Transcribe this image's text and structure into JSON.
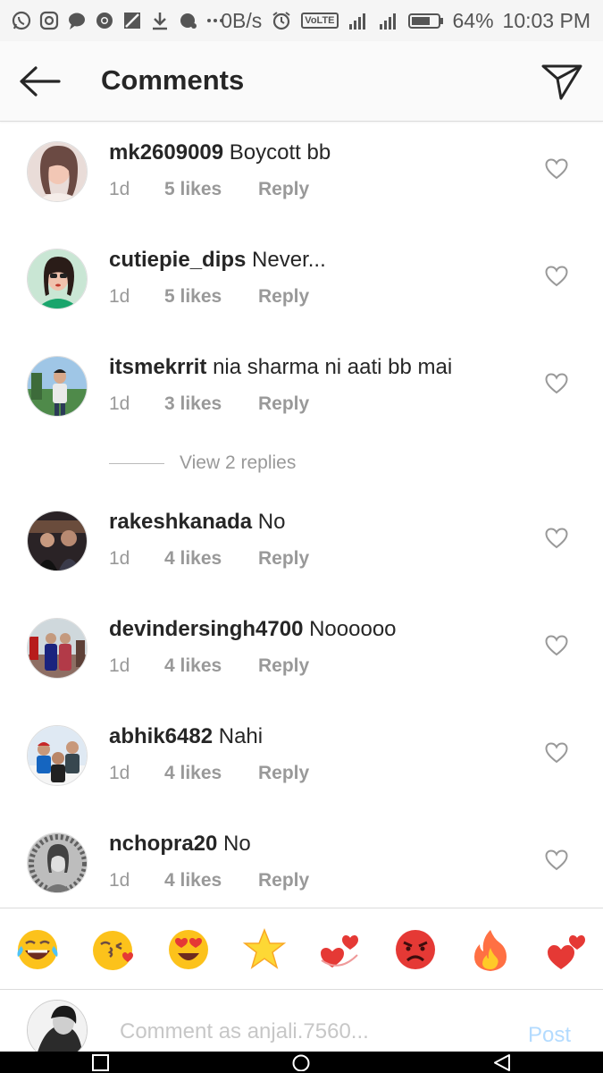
{
  "status_bar": {
    "net_speed": "0B/s",
    "network_badge": "VoLTE",
    "battery": "64%",
    "time": "10:03 PM"
  },
  "header": {
    "title": "Comments"
  },
  "comments": [
    {
      "username": "mk2609009",
      "text": "Boycott bb",
      "age": "1d",
      "likes": "5 likes",
      "reply": "Reply"
    },
    {
      "username": "cutiepie_dips",
      "text": "Never...",
      "age": "1d",
      "likes": "5 likes",
      "reply": "Reply"
    },
    {
      "username": "itsmekrrit",
      "text": "nia sharma ni aati bb mai",
      "age": "1d",
      "likes": "3 likes",
      "reply": "Reply"
    },
    {
      "username": "rakeshkanada",
      "text": "No",
      "age": "1d",
      "likes": "4 likes",
      "reply": "Reply"
    },
    {
      "username": "devindersingh4700",
      "text": "Noooooo",
      "age": "1d",
      "likes": "4 likes",
      "reply": "Reply"
    },
    {
      "username": "abhik6482",
      "text": "Nahi",
      "age": "1d",
      "likes": "4 likes",
      "reply": "Reply"
    },
    {
      "username": "nchopra20",
      "text": "No",
      "age": "1d",
      "likes": "4 likes",
      "reply": "Reply"
    }
  ],
  "view_replies": "View 2 replies",
  "emoji_bar": [
    "joy-emoji",
    "kissing-heart-emoji",
    "heart-eyes-emoji",
    "star-emoji",
    "revolving-hearts-emoji",
    "angry-emoji",
    "fire-emoji",
    "two-hearts-emoji"
  ],
  "composer": {
    "placeholder": "Comment as anjali.7560...",
    "post_label": "Post"
  },
  "colors": {
    "text": "#262626",
    "meta": "#999999",
    "post_disabled": "#b3dbff",
    "divider": "#dbdbdb"
  }
}
